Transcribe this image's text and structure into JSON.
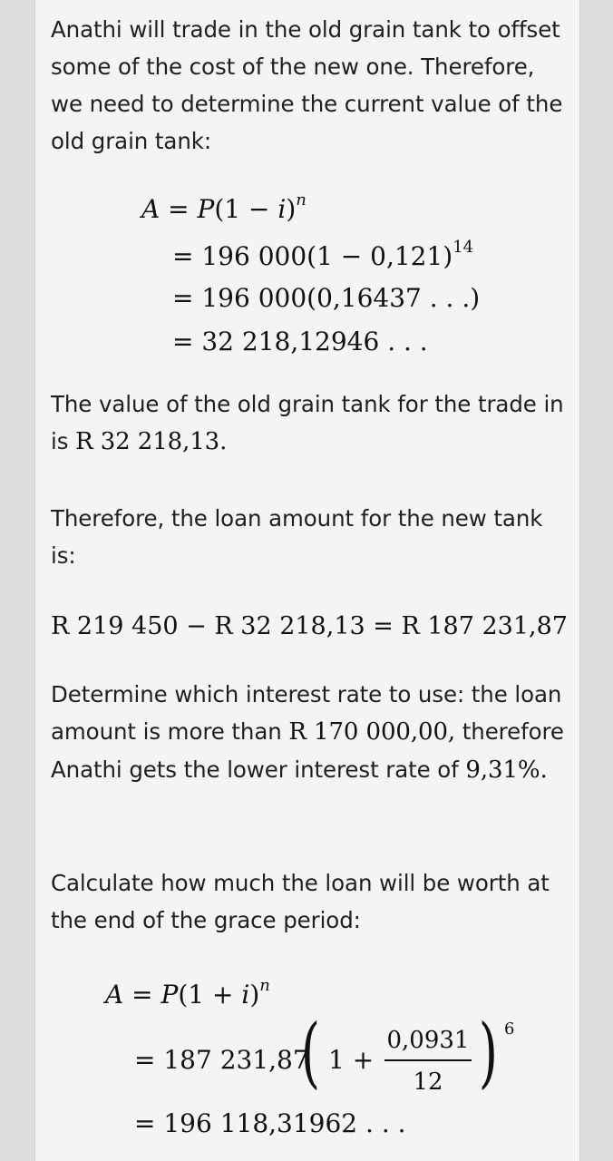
{
  "paragraphs": {
    "p1": "Anathi will trade in the old grain tank to offset some of the cost of the new one. Therefore, we need to determine the current value of the old grain tank:",
    "p2_text": "The value of the old grain tank for the trade in is ",
    "p2_math": "R 32 218,13.",
    "p3": "Therefore, the loan amount for the new tank is:",
    "p4_text1": "Determine which interest rate to use: the loan amount is more than ",
    "p4_math1": "R 170 000,00,",
    "p4_text2": " therefore Anathi gets the lower interest rate of ",
    "p4_math2": "9,31%.",
    "p5": "Calculate how much the loan will be worth at the end of the grace period:"
  },
  "equations": {
    "eq1": {
      "l1_lhs": "A",
      "l1_rhs_a": "= ",
      "l1_P": "P",
      "l1_paren": "(1 − ",
      "l1_i": "i",
      "l1_close": ")",
      "l1_n": "n",
      "l2": "= 196 000(1 − 0,121)",
      "l2_exp": "14",
      "l3": "= 196 000(0,16437 . . .)",
      "l4": "= 32 218,12946 . . ."
    },
    "loan_line": "R 219 450 − R 32 218,13 = R 187 231,87",
    "eq2": {
      "l1_lhs": "A",
      "l1_eq": "= ",
      "l1_P": "P",
      "l1_paren": "(1 + ",
      "l1_i": "i",
      "l1_close": ")",
      "l1_n": "n",
      "l2_pre": "= 187 231,87",
      "l2_one_plus": "1 +",
      "l2_num": "0,0931",
      "l2_den": "12",
      "l2_exp": "6",
      "l3": "= 196 118,31962 . . ."
    }
  }
}
